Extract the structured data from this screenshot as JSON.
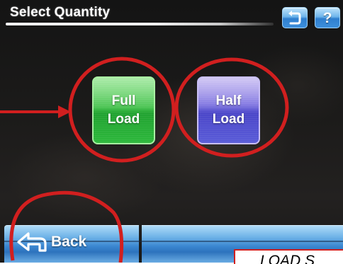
{
  "header": {
    "title": "Select Quantity",
    "back_icon": "return-arrow-icon",
    "help_label": "?"
  },
  "options": [
    {
      "line1": "Full",
      "line2": "Load",
      "color": "#2db83c"
    },
    {
      "line1": "Half",
      "line2": "Load",
      "color": "#5a5cd8"
    }
  ],
  "footer": {
    "back_label": "Back",
    "back_icon": "back-arrow-icon"
  },
  "annotation": {
    "caption": "LOAD S",
    "color": "#d11f1f"
  }
}
